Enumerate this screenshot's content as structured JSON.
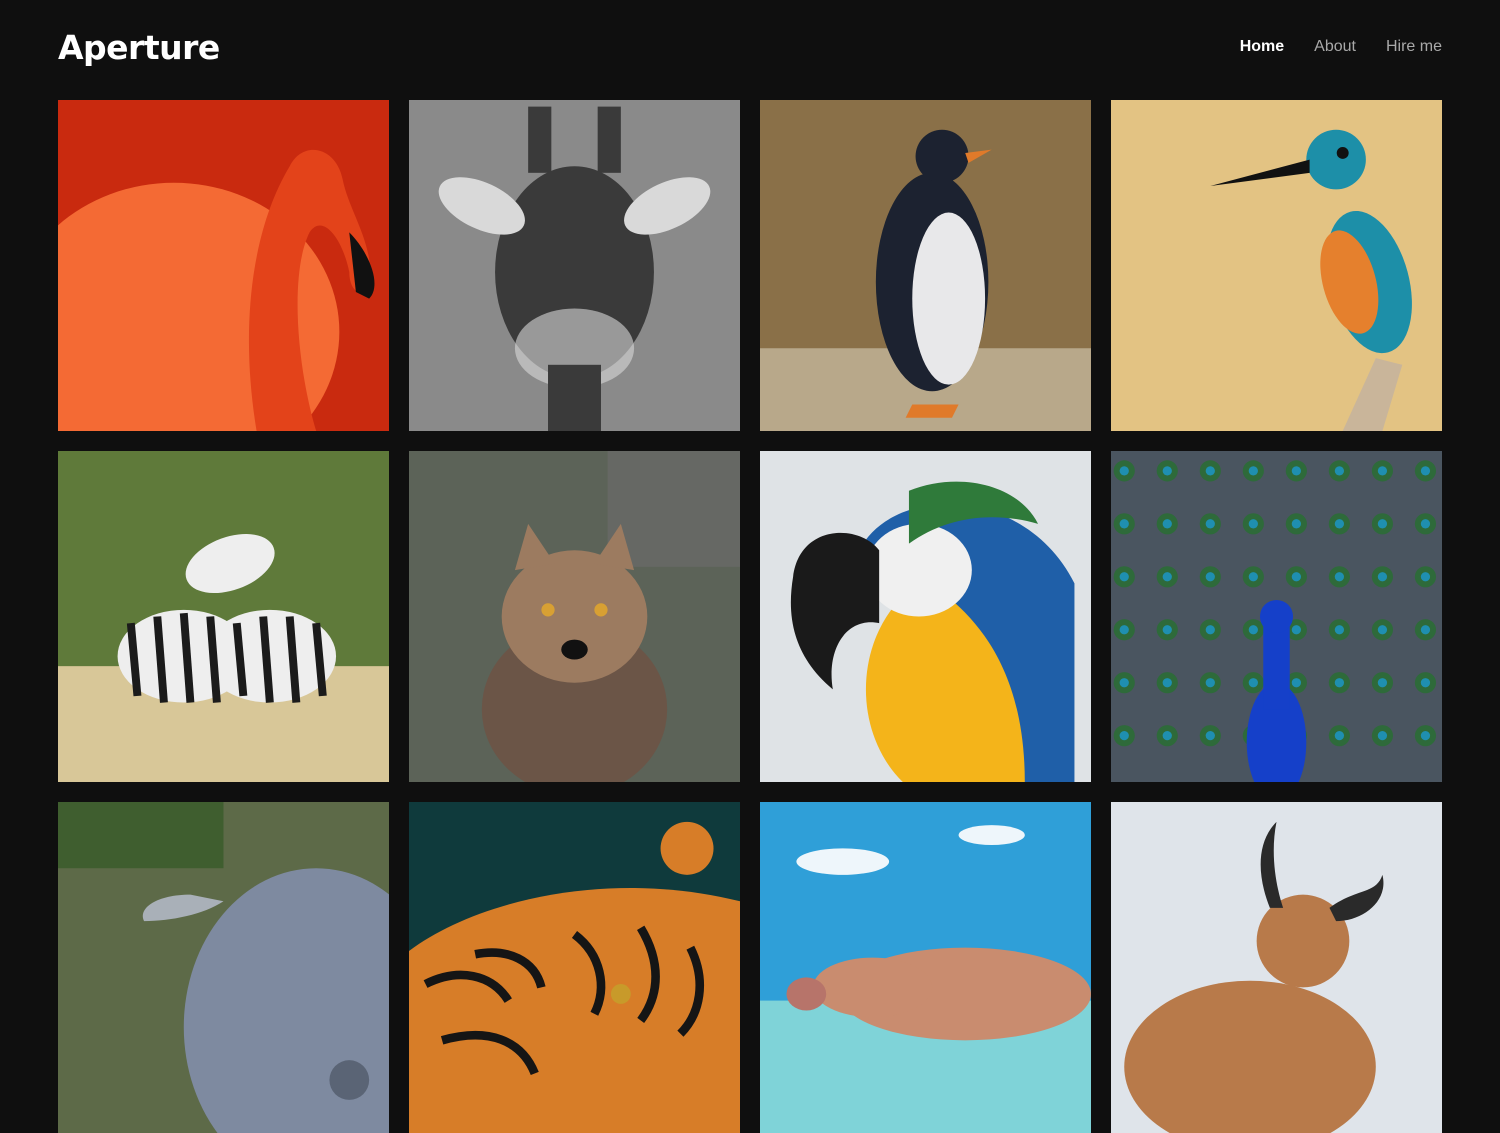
{
  "site": {
    "title": "Aperture"
  },
  "nav": {
    "items": [
      {
        "label": "Home",
        "active": true
      },
      {
        "label": "About",
        "active": false
      },
      {
        "label": "Hire me",
        "active": false
      }
    ]
  },
  "gallery": {
    "photos": [
      {
        "subject": "flamingo",
        "colors": [
          "#e3431a",
          "#ff7a3d",
          "#c92a0f"
        ]
      },
      {
        "subject": "giraffe",
        "colors": [
          "#d9d9d9",
          "#3a3a3a",
          "#8a8a8a"
        ]
      },
      {
        "subject": "penguin",
        "colors": [
          "#8a7048",
          "#1c2230",
          "#e8e8ea"
        ]
      },
      {
        "subject": "kingfisher",
        "colors": [
          "#e3c383",
          "#1d8fa8",
          "#e5802d"
        ]
      },
      {
        "subject": "zebras",
        "colors": [
          "#5f7a3a",
          "#d8c798",
          "#1b1b1b"
        ]
      },
      {
        "subject": "arctic-fox",
        "colors": [
          "#5c6358",
          "#6b5547",
          "#9c7b60"
        ]
      },
      {
        "subject": "macaw",
        "colors": [
          "#dfe3e6",
          "#f4b41a",
          "#1f5fa8"
        ]
      },
      {
        "subject": "peacock",
        "colors": [
          "#4a5560",
          "#2e6a3a",
          "#1540c9"
        ]
      },
      {
        "subject": "pig",
        "colors": [
          "#7e8aa0",
          "#5d6a48",
          "#a9b0b8"
        ]
      },
      {
        "subject": "tiger",
        "colors": [
          "#0f3a3c",
          "#d77d28",
          "#151515"
        ]
      },
      {
        "subject": "swimming-pig",
        "colors": [
          "#2f9fd8",
          "#c98c6f",
          "#7fd3d8"
        ]
      },
      {
        "subject": "highland-cow",
        "colors": [
          "#dfe4ea",
          "#b87a4a",
          "#2a2a2a"
        ]
      }
    ]
  }
}
